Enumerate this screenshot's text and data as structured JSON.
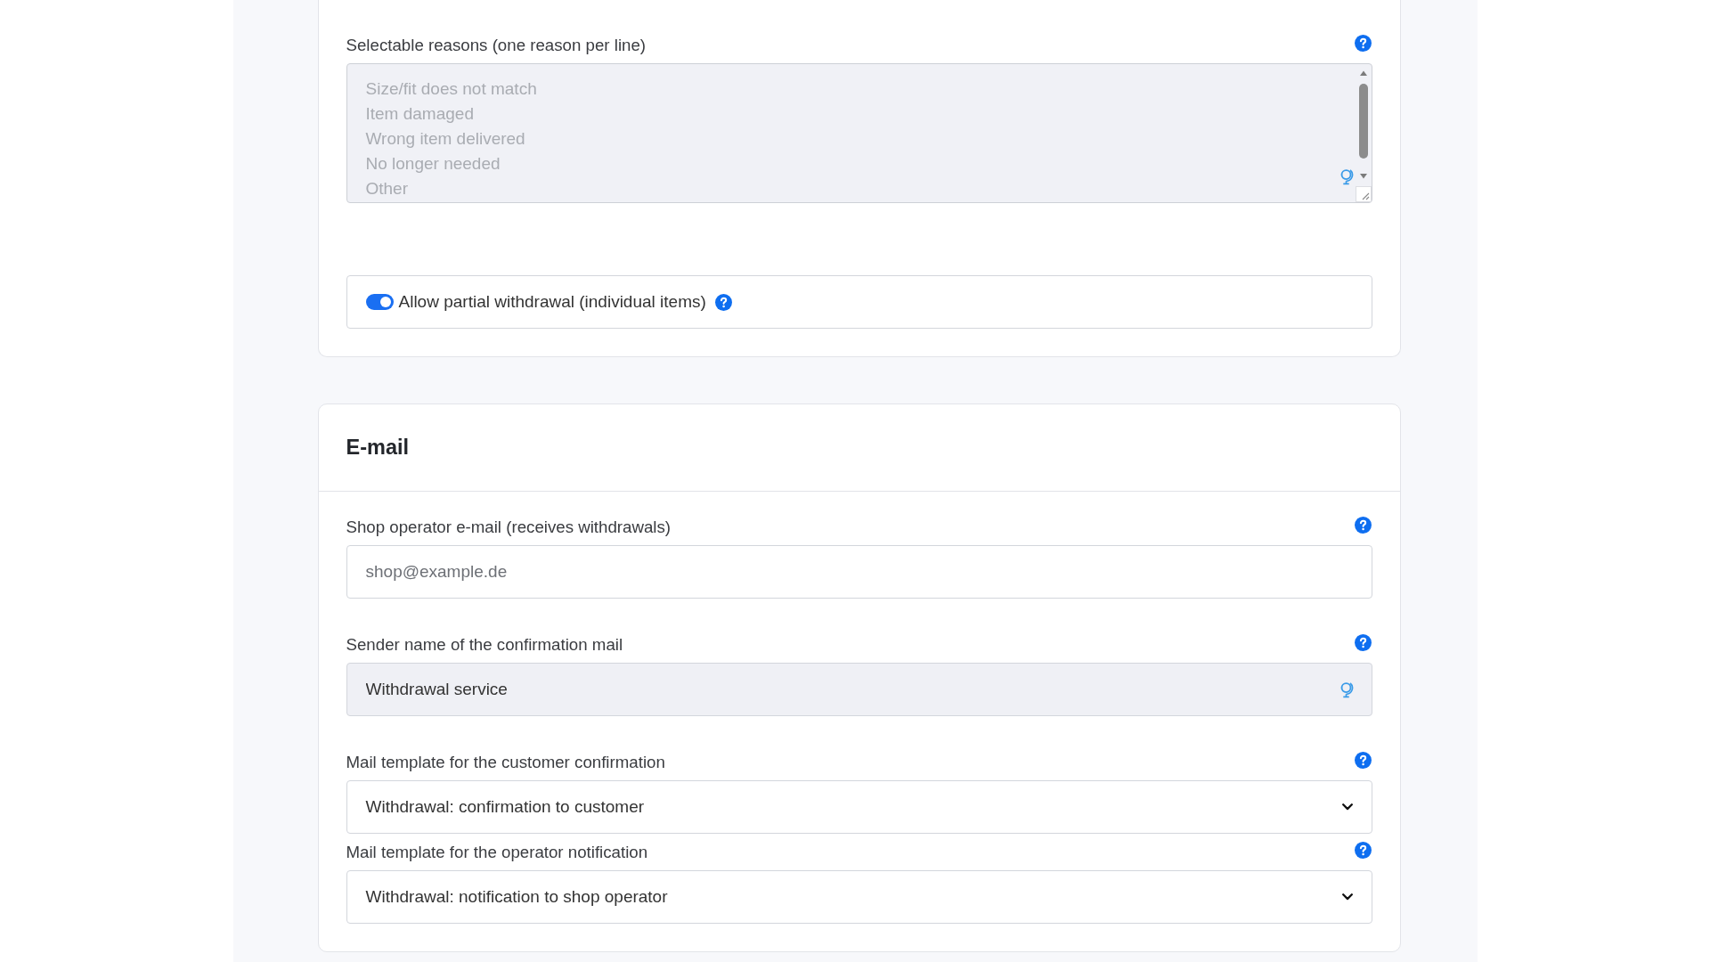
{
  "cards": [
    {
      "fields": [
        {
          "kind": "textarea",
          "label": "Selectable reasons (one reason per line)",
          "lines": [
            "Size/fit does not match",
            "Item damaged",
            "Wrong item delivered",
            "No longer needed",
            "Other"
          ],
          "disabled": true,
          "translatable": true
        },
        {
          "kind": "toggle",
          "label": "Allow partial withdrawal (individual items)",
          "on": true
        }
      ]
    },
    {
      "title": "E-mail",
      "fields": [
        {
          "kind": "input",
          "label": "Shop operator e-mail (receives withdrawals)",
          "placeholder": "shop@example.de",
          "readonly": false,
          "translatable": false
        },
        {
          "kind": "input",
          "label": "Sender name of the confirmation mail",
          "value": "Withdrawal service",
          "readonly": true,
          "translatable": true
        },
        {
          "kind": "select",
          "label": "Mail template for the customer confirmation",
          "value": "Withdrawal: confirmation to customer"
        },
        {
          "kind": "select",
          "label": "Mail template for the operator notification",
          "value": "Withdrawal: notification to shop operator"
        }
      ]
    }
  ]
}
